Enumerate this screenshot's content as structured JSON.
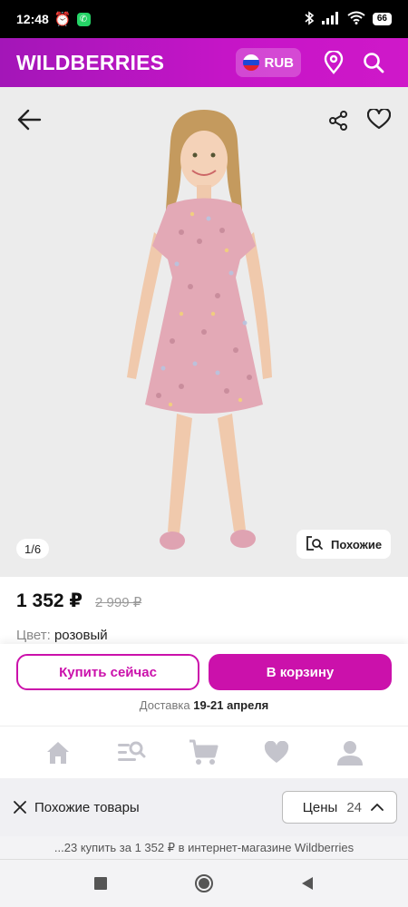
{
  "status_bar": {
    "time": "12:48",
    "battery": "66"
  },
  "header": {
    "brand": "WILDBERRIES",
    "currency": "RUB",
    "colors": {
      "gradient_start": "#a316b8",
      "gradient_end": "#cf18c9"
    }
  },
  "gallery": {
    "counter": "1/6",
    "similar_label": "Похожие",
    "icons": [
      "back-arrow-icon",
      "share-icon",
      "heart-icon",
      "similar-search-icon"
    ]
  },
  "product": {
    "price": "1 352 ₽",
    "old_price": "2 999 ₽",
    "color_label": "Цвет:",
    "color_value": "розовый"
  },
  "actions": {
    "buy_now": "Купить сейчас",
    "add_to_cart": "В корзину",
    "delivery_label": "Доставка",
    "delivery_date": "19-21 апреля",
    "accent": "#cb11ab"
  },
  "bottom_nav": {
    "items": [
      "home-icon",
      "catalog-search-icon",
      "cart-icon",
      "favorites-icon",
      "profile-icon"
    ]
  },
  "similar_bar": {
    "title": "Похожие товары",
    "prices_label": "Цены",
    "prices_count": "24"
  },
  "caption": "...23 купить за 1 352 ₽ в интернет-магазине Wildberries"
}
